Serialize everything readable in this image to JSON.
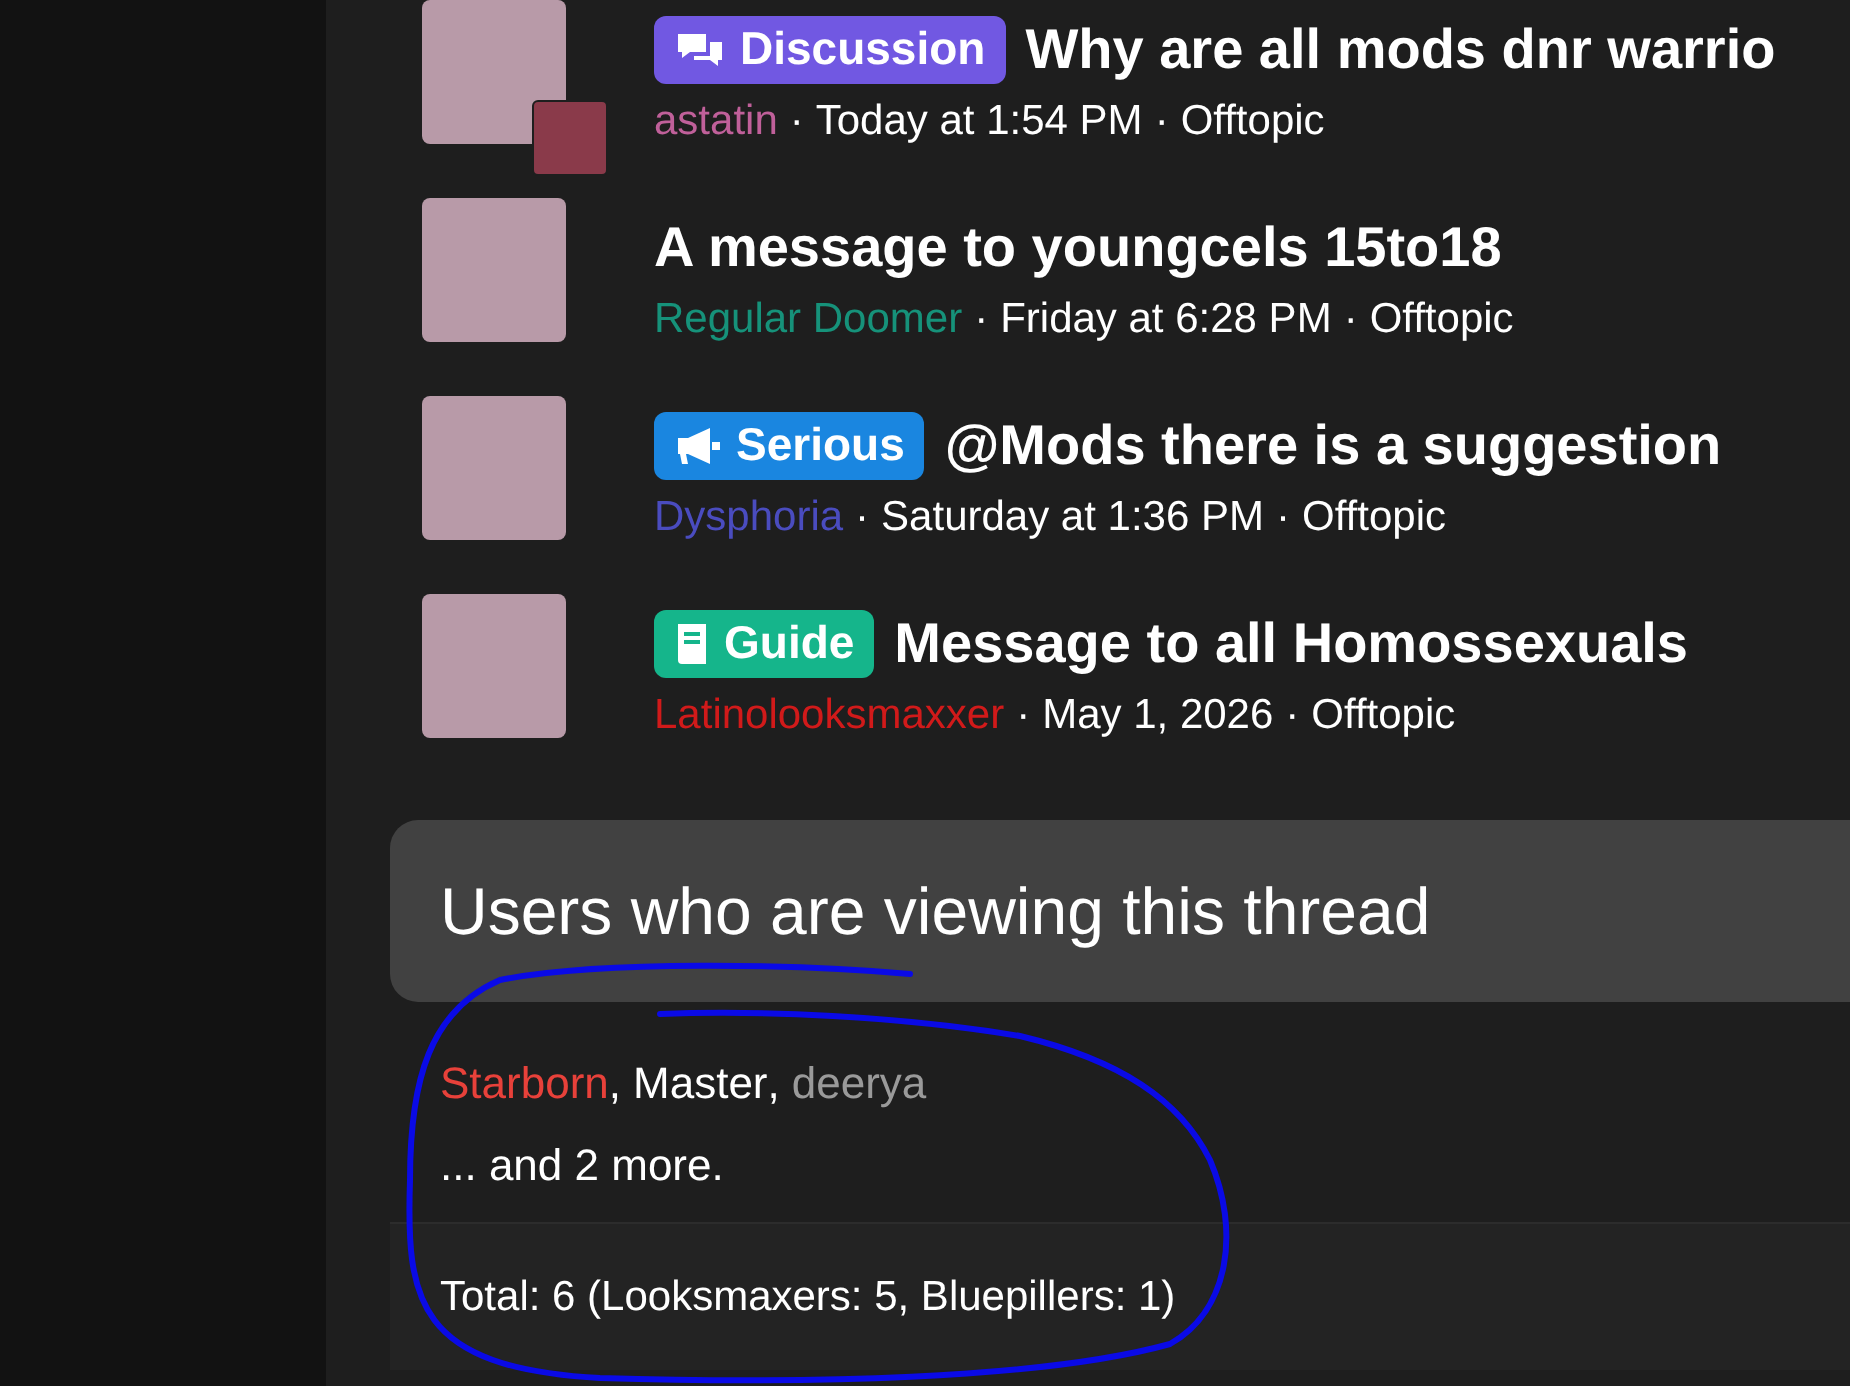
{
  "threads": [
    {
      "prefix": {
        "label": "Discussion",
        "kind": "discussion",
        "color": "#7158e2"
      },
      "title": "Why are all mods dnr warrio",
      "author": "astatin",
      "color": "#c0609a",
      "separator": "·",
      "date": "Today at 1:54 PM",
      "forum": "Offtopic",
      "second_avatar": true
    },
    {
      "title": "A message to youngcels 15to18",
      "author": "Regular Doomer",
      "color": "#16927a",
      "separator": "·",
      "date": "Friday at 6:28 PM",
      "forum": "Offtopic",
      "second_avatar": false
    },
    {
      "prefix": {
        "label": "Serious",
        "kind": "serious",
        "color": "#1a86e0"
      },
      "title": "@Mods there is a suggestion",
      "author": "Dysphoria",
      "color": "#4a4cbf",
      "separator": "·",
      "date": "Saturday at 1:36 PM",
      "forum": "Offtopic",
      "second_avatar": false
    },
    {
      "prefix": {
        "label": "Guide",
        "kind": "guide",
        "color": "#15b58b"
      },
      "title": "Message to all Homossexuals",
      "author": "Latinolooksmaxxer",
      "color": "#d11a1a",
      "separator": "·",
      "date": "May 1, 2026",
      "forum": "Offtopic",
      "second_avatar": false
    }
  ],
  "viewers": {
    "title": "Users who are viewing this thread",
    "users": [
      {
        "name": "Starborn",
        "color": "#e8413a"
      },
      {
        "name": "Master",
        "color": "#ffffff"
      },
      {
        "name": "deerya",
        "color": "#9a9a9a"
      }
    ],
    "separator": ",",
    "more": "... and 2 more.",
    "total": "Total: 6 (Looksmaxers: 5, Bluepillers: 1)"
  }
}
